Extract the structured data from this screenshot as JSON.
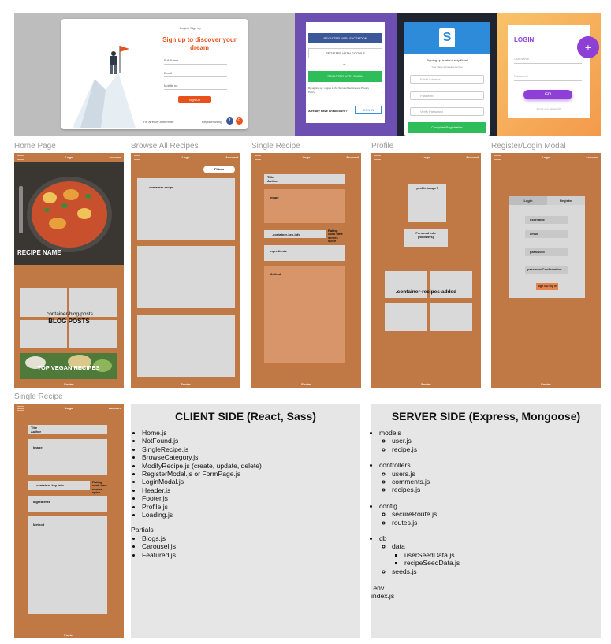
{
  "signup_card": {
    "breadcrumb": "Login / Sign up",
    "headline": "Sign up to discover your dream",
    "fields": [
      "Full Name",
      "Email",
      "Mobile no"
    ],
    "button": "Sign Up",
    "footer_left": "I'm already a member",
    "footer_right": "Register using"
  },
  "purple_card": {
    "facebook": "REGISTER WITH FACEBOOK",
    "google": "REGISTER WITH GOOGLE",
    "or": "or",
    "email": "REGISTER WITH EMAIL",
    "terms": "By signing up, I agree to the Terms of Service and Privacy Policy",
    "already": "Already have an account?",
    "sign_in": "SIGN IN"
  },
  "dark_card": {
    "headline": "Signing up is absolutely Free!",
    "sub": "Your ideas will always be free",
    "fields": [
      "Email Address",
      "Password",
      "Verify Password"
    ],
    "button": "Complete Registration"
  },
  "orange_card": {
    "title": "LOGIN",
    "fields": [
      "UserName",
      "Password"
    ],
    "button": "GO",
    "forgot": "Forgot your password?",
    "fab": "+"
  },
  "captions": {
    "home": "Home Page",
    "browse": "Browse All  Recipes",
    "single": "Single Recipe",
    "profile": "Profile",
    "register": "Register/Login Modal",
    "single2": "Single Recipe"
  },
  "wire": {
    "logo": "Logo",
    "account": "Account",
    "footer": "Footer"
  },
  "home": {
    "recipe_name": "RECIPE NAME",
    "blog_label": ".container-blog-posts",
    "blog_title": "BLOG POSTS",
    "vegan": "TOP VEGAN RECIPES"
  },
  "browse": {
    "filters": "Filters",
    "container": ".container-recipe"
  },
  "single": {
    "title": "Title",
    "author": "Author",
    "image": "Image",
    "key_info": ".container-key-info",
    "rating": "Rating",
    "cook_time": "cook time",
    "serves": "serves",
    "spice": "spice",
    "ingredients": "Ingredients",
    "method": "Method"
  },
  "profile": {
    "image": "profile image?",
    "personal": "Personal info",
    "followers": "(followers)",
    "added": ".container-recipes-added"
  },
  "modal": {
    "tab_login": "Login",
    "tab_register": "Register",
    "username": "username",
    "email": "email",
    "password": "password",
    "confirm": "passwordConfirmation",
    "submit": "sign up/ log in"
  },
  "client": {
    "heading": "CLIENT SIDE (React, Sass)",
    "files": [
      "Home.js",
      "NotFound.js",
      "SingleRecipe.js",
      "BrowseCategory.js",
      "ModifyRecipe.js (create, update, delete)",
      "RegisterModal.js or FormPage.js",
      "LoginModal.js",
      "Header.js",
      "Footer.js",
      "Profile.js",
      "Loading.js"
    ],
    "partials_label": "Partials",
    "partials": [
      "Blogs.js",
      "Carousel.js",
      "Featured.js"
    ]
  },
  "server": {
    "heading": "SERVER SIDE (Express, Mongoose)",
    "models": "models",
    "models_items": [
      "user.js",
      "recipe.js"
    ],
    "controllers": "controllers",
    "controllers_items": [
      "users.js",
      "comments.js",
      "recipes.js"
    ],
    "config": "config",
    "config_items": [
      "secureRoute.js",
      "routes.js"
    ],
    "db": "db",
    "data": "data",
    "data_items": [
      "userSeedData.js",
      "recipeSeedData.js"
    ],
    "seeds": "seeds.js",
    "env": ".env",
    "index": "index.js"
  },
  "colors": {
    "wireframe_bg": "#c07944",
    "placeholder": "#d9d9d9",
    "text_panel": "#e6e6e6",
    "signup_accent": "#e8501c",
    "facebook": "#3b5998",
    "green": "#2ebd59",
    "purple": "#8e3fd6"
  }
}
